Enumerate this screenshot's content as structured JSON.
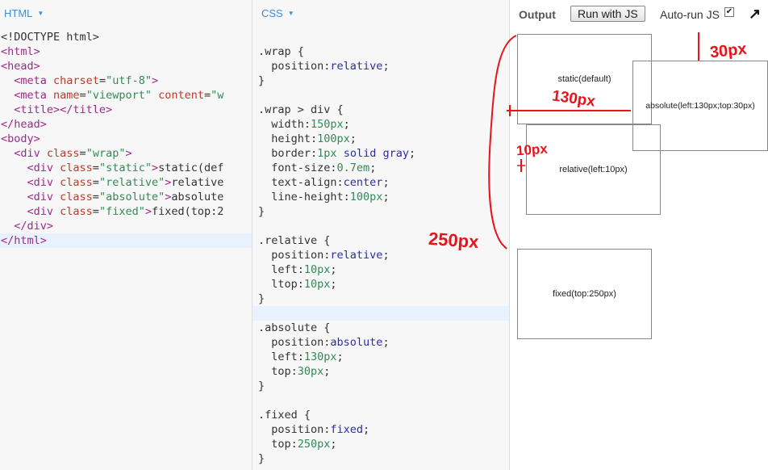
{
  "html_panel": {
    "tab_label": "HTML",
    "lines": [
      [
        [
          "t-plain",
          "<!DOCTYPE html>"
        ]
      ],
      [
        [
          "t-tag",
          "<html>"
        ]
      ],
      [
        [
          "t-tag",
          "<head>"
        ]
      ],
      [
        [
          "t-plain",
          "  "
        ],
        [
          "t-tag",
          "<meta "
        ],
        [
          "t-attr",
          "charset"
        ],
        [
          "t-plain",
          "="
        ],
        [
          "t-str",
          "\"utf-8\""
        ],
        [
          "t-tag",
          ">"
        ]
      ],
      [
        [
          "t-plain",
          "  "
        ],
        [
          "t-tag",
          "<meta "
        ],
        [
          "t-attr",
          "name"
        ],
        [
          "t-plain",
          "="
        ],
        [
          "t-str",
          "\"viewport\""
        ],
        [
          "t-plain",
          " "
        ],
        [
          "t-attr",
          "content"
        ],
        [
          "t-plain",
          "="
        ],
        [
          "t-str",
          "\"w"
        ]
      ],
      [
        [
          "t-plain",
          "  "
        ],
        [
          "t-tag",
          "<title></title>"
        ]
      ],
      [
        [
          "t-tag",
          "</head>"
        ]
      ],
      [
        [
          "t-tag",
          "<body>"
        ]
      ],
      [
        [
          "t-plain",
          "  "
        ],
        [
          "t-tag",
          "<div "
        ],
        [
          "t-attr",
          "class"
        ],
        [
          "t-plain",
          "="
        ],
        [
          "t-str",
          "\"wrap\""
        ],
        [
          "t-tag",
          ">"
        ]
      ],
      [
        [
          "t-plain",
          "    "
        ],
        [
          "t-tag",
          "<div "
        ],
        [
          "t-attr",
          "class"
        ],
        [
          "t-plain",
          "="
        ],
        [
          "t-str",
          "\"static\""
        ],
        [
          "t-tag",
          ">"
        ],
        [
          "t-plain",
          "static(def"
        ]
      ],
      [
        [
          "t-plain",
          "    "
        ],
        [
          "t-tag",
          "<div "
        ],
        [
          "t-attr",
          "class"
        ],
        [
          "t-plain",
          "="
        ],
        [
          "t-str",
          "\"relative\""
        ],
        [
          "t-tag",
          ">"
        ],
        [
          "t-plain",
          "relative"
        ]
      ],
      [
        [
          "t-plain",
          "    "
        ],
        [
          "t-tag",
          "<div "
        ],
        [
          "t-attr",
          "class"
        ],
        [
          "t-plain",
          "="
        ],
        [
          "t-str",
          "\"absolute\""
        ],
        [
          "t-tag",
          ">"
        ],
        [
          "t-plain",
          "absolute"
        ]
      ],
      [
        [
          "t-plain",
          "    "
        ],
        [
          "t-tag",
          "<div "
        ],
        [
          "t-attr",
          "class"
        ],
        [
          "t-plain",
          "="
        ],
        [
          "t-str",
          "\"fixed\""
        ],
        [
          "t-tag",
          ">"
        ],
        [
          "t-plain",
          "fixed(top:2"
        ]
      ],
      [
        [
          "t-plain",
          "  "
        ],
        [
          "t-tag",
          "</div>"
        ]
      ],
      [
        [
          "t-tag",
          "</html>"
        ]
      ]
    ]
  },
  "css_panel": {
    "tab_label": "CSS",
    "lines": [
      [],
      [
        [
          "t-plain",
          ".wrap {"
        ]
      ],
      [
        [
          "t-plain",
          "  position:"
        ],
        [
          "t-val",
          "relative"
        ],
        [
          "t-plain",
          ";"
        ]
      ],
      [
        [
          "t-plain",
          "}"
        ]
      ],
      [],
      [
        [
          "t-plain",
          ".wrap > div {"
        ]
      ],
      [
        [
          "t-plain",
          "  width:"
        ],
        [
          "t-num",
          "150px"
        ],
        [
          "t-plain",
          ";"
        ]
      ],
      [
        [
          "t-plain",
          "  height:"
        ],
        [
          "t-num",
          "100px"
        ],
        [
          "t-plain",
          ";"
        ]
      ],
      [
        [
          "t-plain",
          "  border:"
        ],
        [
          "t-num",
          "1px"
        ],
        [
          "t-plain",
          " "
        ],
        [
          "t-val",
          "solid gray"
        ],
        [
          "t-plain",
          ";"
        ]
      ],
      [
        [
          "t-plain",
          "  font-size:"
        ],
        [
          "t-num",
          "0.7em"
        ],
        [
          "t-plain",
          ";"
        ]
      ],
      [
        [
          "t-plain",
          "  text-align:"
        ],
        [
          "t-val",
          "center"
        ],
        [
          "t-plain",
          ";"
        ]
      ],
      [
        [
          "t-plain",
          "  line-height:"
        ],
        [
          "t-num",
          "100px"
        ],
        [
          "t-plain",
          ";"
        ]
      ],
      [
        [
          "t-plain",
          "}"
        ]
      ],
      [],
      [
        [
          "t-plain",
          ".relative {"
        ]
      ],
      [
        [
          "t-plain",
          "  position:"
        ],
        [
          "t-val",
          "relative"
        ],
        [
          "t-plain",
          ";"
        ]
      ],
      [
        [
          "t-plain",
          "  left:"
        ],
        [
          "t-num",
          "10px"
        ],
        [
          "t-plain",
          ";"
        ]
      ],
      [
        [
          "t-plain",
          "  ltop:"
        ],
        [
          "t-num",
          "10px"
        ],
        [
          "t-plain",
          ";"
        ]
      ],
      [
        [
          "t-plain",
          "}"
        ]
      ],
      [],
      [
        [
          "t-plain",
          ".absolute {"
        ]
      ],
      [
        [
          "t-plain",
          "  position:"
        ],
        [
          "t-val",
          "absolute"
        ],
        [
          "t-plain",
          ";"
        ]
      ],
      [
        [
          "t-plain",
          "  left:"
        ],
        [
          "t-num",
          "130px"
        ],
        [
          "t-plain",
          ";"
        ]
      ],
      [
        [
          "t-plain",
          "  top:"
        ],
        [
          "t-num",
          "30px"
        ],
        [
          "t-plain",
          ";"
        ]
      ],
      [
        [
          "t-plain",
          "}"
        ]
      ],
      [],
      [
        [
          "t-plain",
          ".fixed {"
        ]
      ],
      [
        [
          "t-plain",
          "  position:"
        ],
        [
          "t-val",
          "fixed"
        ],
        [
          "t-plain",
          ";"
        ]
      ],
      [
        [
          "t-plain",
          "  top:"
        ],
        [
          "t-num",
          "250px"
        ],
        [
          "t-plain",
          ";"
        ]
      ],
      [
        [
          "t-plain",
          "}"
        ]
      ]
    ]
  },
  "output": {
    "label": "Output",
    "run_button": "Run with JS",
    "autorun_label": "Auto-run JS",
    "checkbox_mark": "✔",
    "expand_glyph": "↗",
    "boxes": {
      "static": "static(default)",
      "relative": "relative(left:10px)",
      "absolute": "absolute(left:130px;top:30px)",
      "fixed": "fixed(top:250px)"
    }
  },
  "annotations": {
    "label_30": "30px",
    "label_130": "130px",
    "label_10": "10px",
    "label_250": "250px",
    "color": "#e8141c"
  }
}
